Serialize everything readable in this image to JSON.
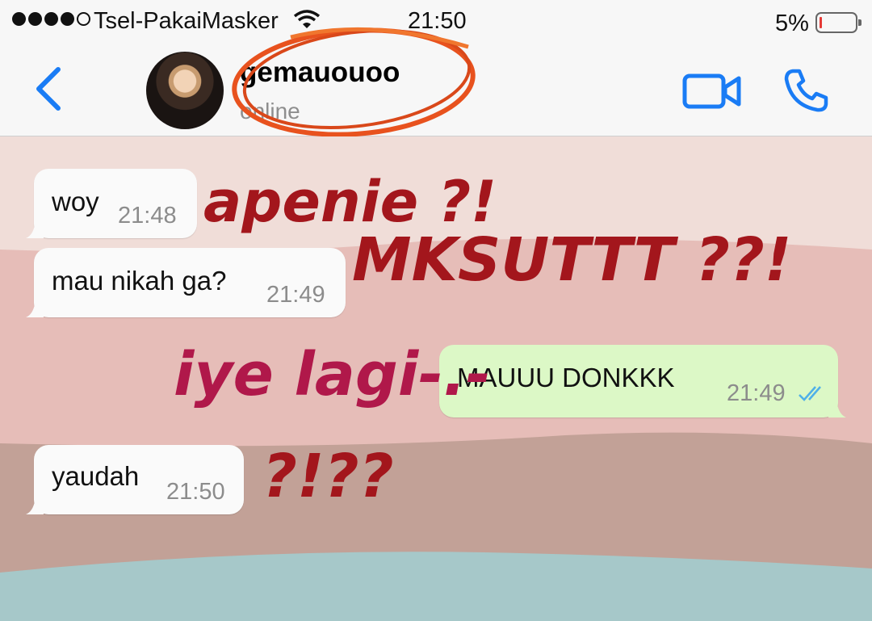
{
  "status_bar": {
    "carrier": "Tsel-PakaiMasker",
    "time": "21:50",
    "battery_percent": "5%",
    "battery_level": 0.05,
    "signal_bars_filled": 4,
    "signal_bars_total": 5
  },
  "header": {
    "contact_name": "gemauouoo",
    "contact_status": "online",
    "back_icon": "chevron-left-icon",
    "video_icon": "video-camera-icon",
    "call_icon": "phone-icon",
    "accent_color": "#1a7cf5"
  },
  "messages": [
    {
      "direction": "in",
      "text": "woy",
      "time": "21:48"
    },
    {
      "direction": "in",
      "text": "mau nikah ga?",
      "time": "21:49"
    },
    {
      "direction": "out",
      "text": "MAUUU DONKKK",
      "time": "21:49",
      "status": "read"
    },
    {
      "direction": "in",
      "text": "yaudah",
      "time": "21:50"
    }
  ],
  "annotations": [
    {
      "text": "apenie ?!",
      "color": "#a3161c"
    },
    {
      "text": "MKSUTTT ??!",
      "color": "#a3161c"
    },
    {
      "text": "iye lagi-.-",
      "color": "#b0184a"
    },
    {
      "text": "?!??",
      "color": "#a3161c"
    }
  ],
  "colors": {
    "incoming_bubble": "#fafafa",
    "outgoing_bubble": "#dcf8c6",
    "wallpaper_top": "#f0ddd8",
    "wallpaper_mid": "#e6bdb8",
    "wallpaper_low": "#c2a197",
    "wallpaper_bottom": "#a6c8c9",
    "read_ticks": "#4fb0e8",
    "circle_scribble": "#e8521e"
  }
}
